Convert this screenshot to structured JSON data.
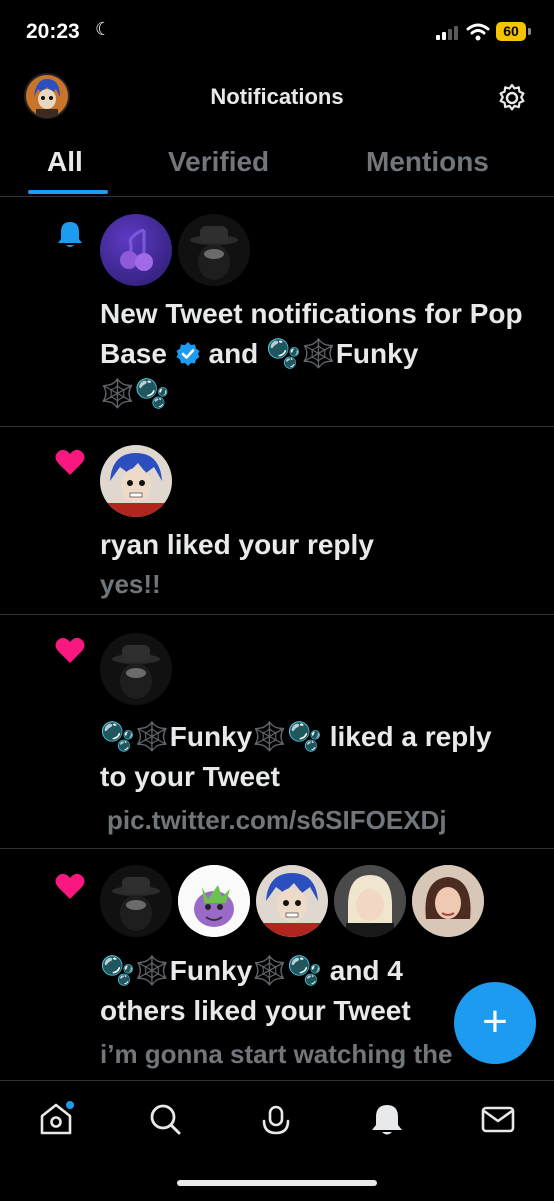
{
  "status_bar": {
    "time": "20:23",
    "battery": "60"
  },
  "header": {
    "title": "Notifications"
  },
  "tabs": [
    {
      "label": "All",
      "active": true
    },
    {
      "label": "Verified",
      "active": false
    },
    {
      "label": "Mentions",
      "active": false
    }
  ],
  "notifications": [
    {
      "type": "new-tweet",
      "icon": "bell-icon",
      "text_part1": "New Tweet notifications for Pop Base",
      "text_part2": "and",
      "text_part3": "Funky",
      "user2_name_trailing": "🫧 🕸️ Funky 🕸️ 🫧"
    },
    {
      "type": "like",
      "icon": "heart-icon",
      "text": "ryan liked your reply",
      "sub": "yes!!"
    },
    {
      "type": "like",
      "icon": "heart-icon",
      "text_name": "Funky",
      "text_line1_rest": "liked a reply",
      "text_line2": "to your Tweet",
      "sub": "pic.twitter.com/s6SIFOEXDj"
    },
    {
      "type": "like",
      "icon": "heart-icon",
      "text_name": "Funky",
      "text_line1_rest": "and 4",
      "text_line2": "others liked your Tweet",
      "sub": "i’m gonna start watching the"
    }
  ],
  "colors": {
    "accent": "#1d9bf0",
    "like": "#f91880",
    "muted": "#71767b"
  },
  "nav": [
    "home-icon",
    "search-icon",
    "spaces-icon",
    "notifications-icon",
    "messages-icon"
  ]
}
